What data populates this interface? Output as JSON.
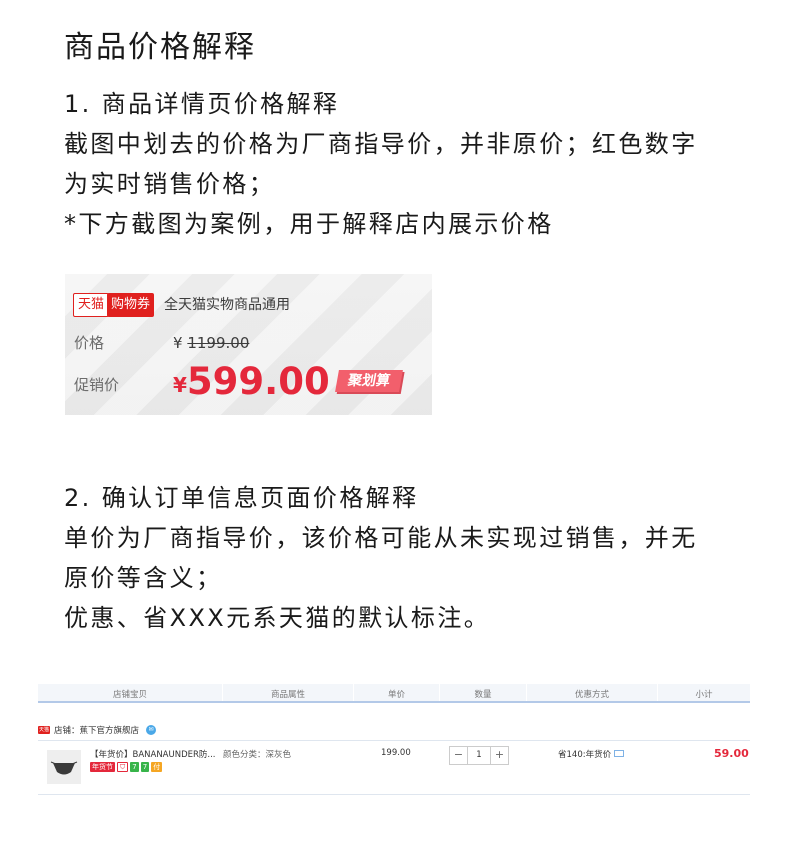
{
  "title": "商品价格解释",
  "section1": {
    "lines": [
      "1. 商品详情页价格解释",
      "截图中划去的价格为厂商指导价，并非原价；红色数字",
      "为实时销售价格；",
      "*下方截图为案例，用于解释店内展示价格"
    ]
  },
  "example1": {
    "tag_tmall": "天猫",
    "tag_coupon": "购物券",
    "coupon_text": "全天猫实物商品通用",
    "price_label": "价格",
    "yen": "¥",
    "old_price": "1199.00",
    "promo_label": "促销价",
    "new_price": "599.00",
    "juhuasuan": "聚划算",
    "colors": {
      "red": "#e4283b",
      "tmall_red": "#e0201e"
    }
  },
  "section2": {
    "lines": [
      "2. 确认订单信息页面价格解释",
      "单价为厂商指导价，该价格可能从未实现过销售，并无",
      "原价等含义；",
      "优惠、省XXX元系天猫的默认标注。"
    ]
  },
  "example2": {
    "headers": [
      "店铺宝贝",
      "商品属性",
      "单价",
      "数量",
      "优惠方式",
      "小计"
    ],
    "shop_icon": "天猫",
    "shop_name": "店铺：蕉下官方旗舰店",
    "product_name": "【年货价】BANANAUNDER防...",
    "product_attr": "颜色分类：深灰色",
    "badges": [
      "年货节",
      "7",
      "7",
      "付"
    ],
    "unit_price": "199.00",
    "qty_minus": "−",
    "qty": "1",
    "qty_plus": "+",
    "discount": "省140:年货价",
    "subtotal": "59.00"
  }
}
